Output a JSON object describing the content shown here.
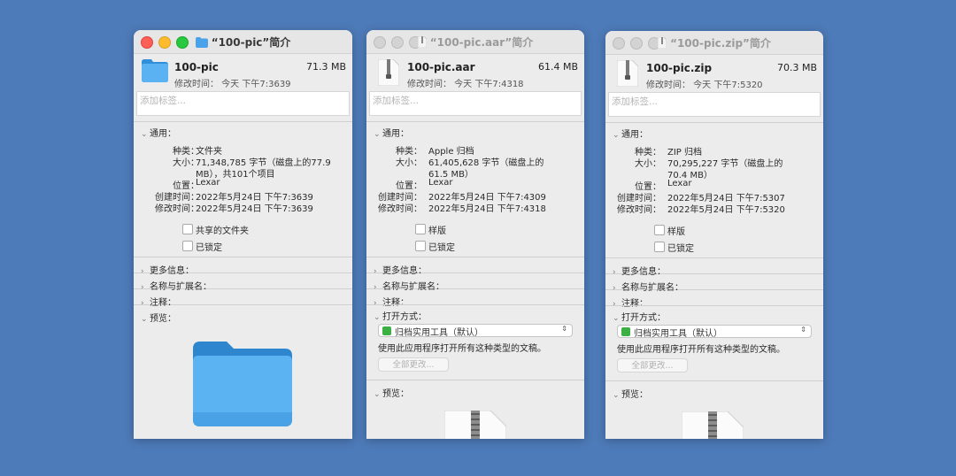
{
  "windows": [
    {
      "title": "“100-pic”简介",
      "name": "100-pic",
      "size": "71.3 MB",
      "modified_line": "修改时间：  今天 下午7:3639",
      "tags_placeholder": "添加标签...",
      "general_label": "通用：",
      "rows": [
        {
          "k": "种类：",
          "v": "文件夹"
        },
        {
          "k": "大小：",
          "v": "71,348,785 字节（磁盘上的77.9"
        },
        {
          "k": "",
          "v": "MB），共101个项目"
        },
        {
          "k": "位置：",
          "v": "Lexar"
        },
        {
          "k": "创建时间：",
          "v": "2022年5月24日 下午7:3639"
        },
        {
          "k": "修改时间：",
          "v": "2022年5月24日 下午7:3639"
        }
      ],
      "checkboxes": [
        "共享的文件夹",
        "已锁定"
      ],
      "more_info": "更多信息：",
      "name_ext": "名称与扩展名：",
      "comments": "注释：",
      "preview": "预览："
    },
    {
      "title": "“100-pic.aar”简介",
      "name": "100-pic.aar",
      "size": "61.4 MB",
      "modified_line": "修改时间：  今天 下午7:4318",
      "tags_placeholder": "添加标签...",
      "general_label": "通用：",
      "rows": [
        {
          "k": "种类：",
          "v": "Apple 归档"
        },
        {
          "k": "大小：",
          "v": "61,405,628 字节（磁盘上的"
        },
        {
          "k": "",
          "v": "61.5 MB）"
        },
        {
          "k": "位置：",
          "v": "Lexar"
        },
        {
          "k": "创建时间：",
          "v": "2022年5月24日 下午7:4309"
        },
        {
          "k": "修改时间：",
          "v": "2022年5月24日 下午7:4318"
        }
      ],
      "checkboxes": [
        "样版",
        "已锁定"
      ],
      "more_info": "更多信息：",
      "name_ext": "名称与扩展名：",
      "comments": "注释：",
      "open_with": "打开方式：",
      "open_app": "归档实用工具（默认）",
      "open_desc": "使用此应用程序打开所有这种类型的文稿。",
      "change_all": "全部更改...",
      "preview": "预览："
    },
    {
      "title": "“100-pic.zip”简介",
      "name": "100-pic.zip",
      "size": "70.3 MB",
      "modified_line": "修改时间：  今天 下午7:5320",
      "tags_placeholder": "添加标签...",
      "general_label": "通用：",
      "rows": [
        {
          "k": "种类：",
          "v": "ZIP 归档"
        },
        {
          "k": "大小：",
          "v": "70,295,227 字节（磁盘上的"
        },
        {
          "k": "",
          "v": "70.4 MB）"
        },
        {
          "k": "位置：",
          "v": "Lexar"
        },
        {
          "k": "创建时间：",
          "v": "2022年5月24日 下午7:5307"
        },
        {
          "k": "修改时间：",
          "v": "2022年5月24日 下午7:5320"
        }
      ],
      "checkboxes": [
        "样版",
        "已锁定"
      ],
      "more_info": "更多信息：",
      "name_ext": "名称与扩展名：",
      "comments": "注释：",
      "open_with": "打开方式：",
      "open_app": "归档实用工具（默认）",
      "open_desc": "使用此应用程序打开所有这种类型的文稿。",
      "change_all": "全部更改...",
      "preview": "预览："
    }
  ]
}
